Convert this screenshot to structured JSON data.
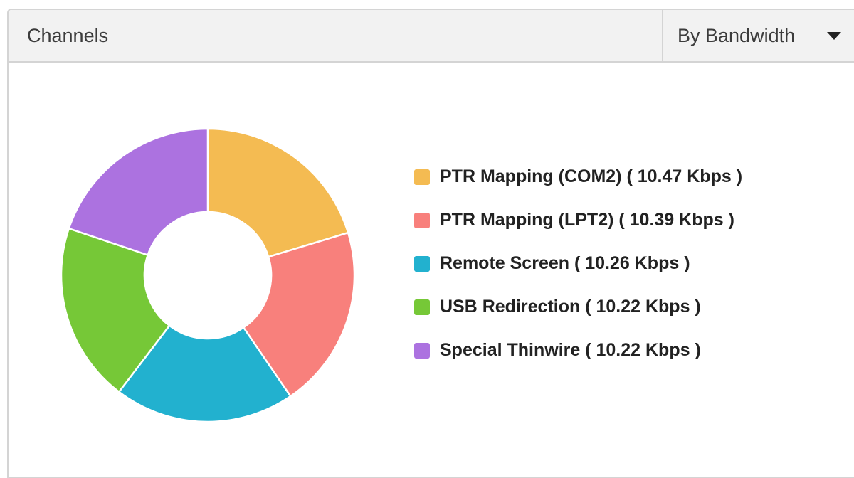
{
  "header": {
    "title": "Channels",
    "metric_selector": {
      "label": "By Bandwidth",
      "icon": "caret-down-icon"
    }
  },
  "chart_data": {
    "type": "pie",
    "style": "donut",
    "unit": "Kbps",
    "legend_position": "right",
    "slices": [
      {
        "label": "PTR Mapping (COM2)",
        "value": 10.47,
        "legend_text": "PTR Mapping (COM2) ( 10.47 Kbps )",
        "color": "#f4bb52"
      },
      {
        "label": "PTR Mapping (LPT2)",
        "value": 10.39,
        "legend_text": "PTR Mapping (LPT2) ( 10.39 Kbps )",
        "color": "#f8807c"
      },
      {
        "label": "Remote Screen",
        "value": 10.26,
        "legend_text": "Remote Screen ( 10.26 Kbps )",
        "color": "#22b1cf"
      },
      {
        "label": "USB Redirection",
        "value": 10.22,
        "legend_text": "USB Redirection ( 10.22 Kbps )",
        "color": "#76c837"
      },
      {
        "label": "Special Thinwire",
        "value": 10.22,
        "legend_text": "Special Thinwire ( 10.22 Kbps )",
        "color": "#ac72e0"
      }
    ]
  }
}
